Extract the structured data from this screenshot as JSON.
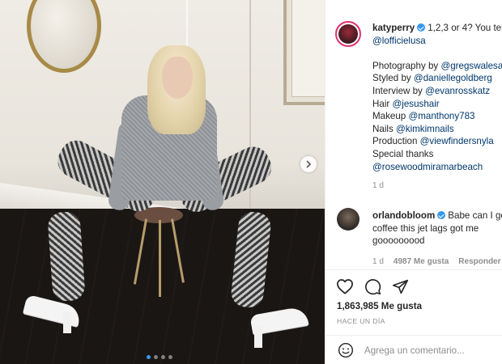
{
  "post": {
    "image_alt": "",
    "carousel": {
      "count": 4,
      "active": 0
    }
  },
  "caption": {
    "username": "katyperry",
    "text_intro": "1,2,3 or 4? You tel",
    "mention_intro": "@lofficielusa",
    "credits": [
      {
        "label": "Photography by ",
        "handle": "@gregswalesa"
      },
      {
        "label": "Styled by ",
        "handle": "@daniellegoldberg"
      },
      {
        "label": "Interview by ",
        "handle": "@evanrosskatz"
      },
      {
        "label": "Hair ",
        "handle": "@jesushair"
      },
      {
        "label": "Makeup ",
        "handle": "@manthony783"
      },
      {
        "label": "Nails ",
        "handle": "@kimkimnails"
      },
      {
        "label": "Production ",
        "handle": "@viewfindersnyla"
      },
      {
        "label": "Special thanks",
        "handle": ""
      },
      {
        "label": "",
        "handle": "@rosewoodmiramarbeach"
      }
    ],
    "time": "1 d"
  },
  "comment": {
    "username": "orlandobloom",
    "text_line1": "Babe can I ge",
    "text_line2": "coffee this jet lags got me",
    "text_line3": "gooooooood",
    "time": "1 d",
    "likes": "4987 Me gusta",
    "reply": "Responder"
  },
  "actions": {
    "likes_count": "1,863,985 Me gusta",
    "time_ago": "HACE UN DÍA",
    "comment_placeholder": "Agrega un comentario..."
  },
  "colors": {
    "verified": "#3897f0",
    "mention": "#00376b",
    "muted": "#8e8e8e",
    "text": "#262626"
  },
  "icons": [
    "heart-icon",
    "comment-icon",
    "share-icon",
    "emoji-icon",
    "chevron-right-icon"
  ]
}
